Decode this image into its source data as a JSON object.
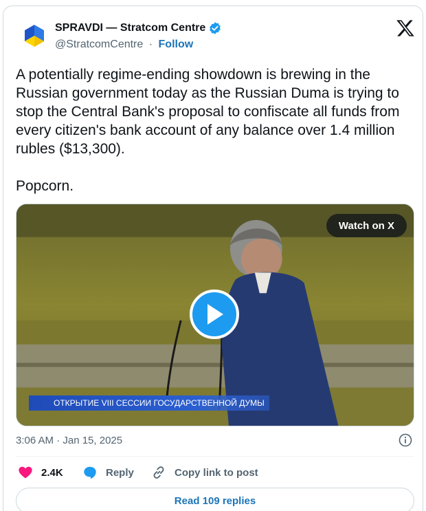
{
  "author": {
    "name": "SPRAVDI — Stratcom Centre",
    "handle": "@StratcomCentre",
    "separator": "·",
    "follow_label": "Follow"
  },
  "tweet": {
    "text": "A potentially regime-ending showdown is brewing in the Russian government today as the Russian Duma is trying to stop the Central Bank's proposal to confiscate all funds from every citizen's bank account of any balance over 1.4 million rubles ($13,300).\n\nPopcorn."
  },
  "media": {
    "watch_label": "Watch on X",
    "caption": "ОТКРЫТИЕ VIII СЕССИИ ГОСУДАРСТВЕННОЙ ДУМЫ"
  },
  "timestamp": "3:06 AM · Jan 15, 2025",
  "actions": {
    "likes": "2.4K",
    "reply_label": "Reply",
    "copy_label": "Copy link to post"
  },
  "read_replies_label": "Read 109 replies",
  "colors": {
    "link": "#1d74b8",
    "like": "#f91880",
    "reply": "#1d9bf0",
    "muted": "#536471"
  },
  "icons": [
    "spravdi-logo",
    "verified-badge-icon",
    "x-logo-icon",
    "play-icon",
    "info-icon",
    "heart-icon",
    "reply-bubble-icon",
    "link-icon"
  ]
}
